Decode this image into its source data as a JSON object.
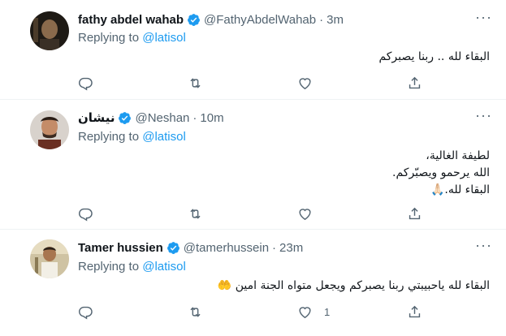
{
  "tweets": [
    {
      "name": "fathy abdel wahab",
      "handle": "@FathyAbdelWahab",
      "time": "3m",
      "replying_prefix": "Replying to ",
      "replying_to": "@latisol",
      "lines": [
        "البقاء لله .. ربنا يصبركم"
      ],
      "like_count": "",
      "avatar_color": "#2b241c"
    },
    {
      "name": "نيشان",
      "handle": "@Neshan",
      "time": "10m",
      "replying_prefix": "Replying to ",
      "replying_to": "@latisol",
      "lines": [
        "لطيفة الغالية،",
        "الله يرحمو ويصبّركم.",
        "البقاء لله.🙏🏻"
      ],
      "like_count": "",
      "avatar_color": "#5a3a2a"
    },
    {
      "name": "Tamer hussien",
      "handle": "@tamerhussein",
      "time": "23m",
      "replying_prefix": "Replying to ",
      "replying_to": "@latisol",
      "lines": [
        "البقاء لله ياحبيبتي ربنا يصبركم ويجعل متواه الجنة امين 🤲"
      ],
      "like_count": "1",
      "avatar_color": "#c9b48a"
    }
  ],
  "separator": "·",
  "colors": {
    "accent": "#1d9bf0",
    "secondary_text": "#536471",
    "divider": "#eff3f4"
  },
  "icons": [
    "verified-badge-icon",
    "more-icon",
    "reply-icon",
    "retweet-icon",
    "like-icon",
    "share-icon"
  ]
}
